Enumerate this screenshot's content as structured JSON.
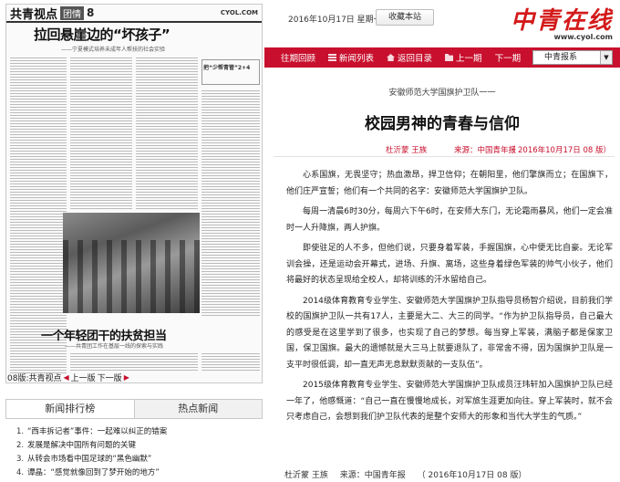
{
  "thumbnail": {
    "column": "共青视点",
    "brand": "团情",
    "page_no": "8",
    "site": "CYOL.COM",
    "headline1": "拉回悬崖边的“坏孩子”",
    "subhead1": "——宁夏模式培养未成年人帮扶的社会实验",
    "headline2": "一个年轻团干的扶贫担当",
    "subhead2": "——共青团工作在基层一线的探索与实践",
    "side_head": "把“少帮青管”2+4"
  },
  "thumb_nav": {
    "label": "08版:共青视点",
    "prev": "上一版",
    "next": "下一版"
  },
  "tabs": [
    "新闻排行榜",
    "热点新闻"
  ],
  "ranking": [
    "“西丰拆记者”事件：一起难以纠正的错案",
    "发展是解决中国所有问题的关键",
    "从转会市场看中国足球的“黑色幽默”",
    "谭晶：“感觉就像回到了梦开始的地方”"
  ],
  "topbar": {
    "date": "2016年10月17日  星期一",
    "fav": "收藏本站",
    "logo": "中青在线",
    "logo_sub": "www.cyol.com"
  },
  "nav": [
    "往期回顾",
    "新闻列表",
    "返回目录",
    "上一期",
    "下一期"
  ],
  "select": "中青报系",
  "article": {
    "kicker": "安徽师范大学国旗护卫队一一",
    "title": "校园男神的青春与信仰",
    "author": "杜沂蒙  王族",
    "source": "来源：中国青年报",
    "date": "（ 2016年10月17日   08 版）",
    "paragraphs": [
      "心系国旗，无畏坚守；热血激昂，捍卫信仰；在朝阳里，他们擎旗而立；在国旗下，他们庄严宣誓；他们有一个共同的名字：安徽师范大学国旗护卫队。",
      "每周一清晨6时30分，每周六下午6时，在安师大东门，无论霜雨暴风，他们一定会准时一人升降旗，两人护旗。",
      "即使驻足的人不多，但他们说，只要身着军装，手握国旗，心中便无比自豪。无论军训会操，还是运动会开幕式，进场、升旗、离场，这些身着绿色军装的帅气小伙子，他们将最好的状态呈现给全校人，却将训练的汗水留给自己。",
      "2014级体育教育专业学生、安徽师范大学国旗护卫队指导员杨智介绍说，目前我们学校的国旗护卫队一共有17人，主要是大二、大三的同学。“作为护卫队指导员，自己最大的感受是在这里学到了很多，也实现了自己的梦想。每当穿上军装，满脑子都是保家卫国，保卫国旗。最大的遗憾就是大三马上就要退队了，非常舍不得，因为国旗护卫队是一支平时很低调，却一直无声无息默默贡献的一支队伍”。",
      "2015级体育教育专业学生、安徽师范大学国旗护卫队成员汪玮轩加入国旗护卫队已经一年了，他感慨道：“自己一直在慢慢地成长，对军旅生涯更加向往。穿上军装时，就不会只考虑自己，会想到我们护卫队代表的是整个安师大的形象和当代大学生的气质。”"
    ],
    "footer_author": "杜沂蒙  王族",
    "footer_source": "来源：中国青年报",
    "footer_date": "（ 2016年10月17日   08 版）"
  },
  "colors": {
    "accent": "#c8102e"
  }
}
